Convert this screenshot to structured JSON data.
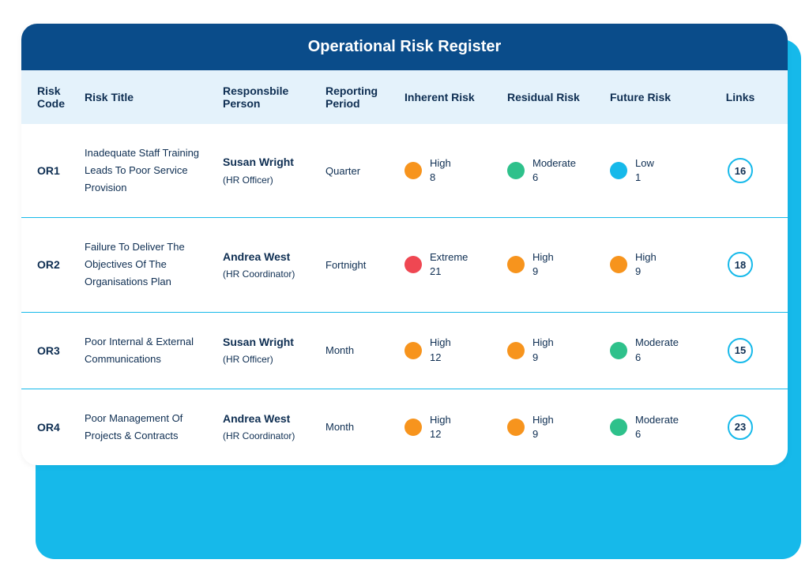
{
  "title": "Operational Risk Register",
  "headers": {
    "code": "Risk Code",
    "title": "Risk Title",
    "person": "Responsbile Person",
    "period": "Reporting Period",
    "inherent": "Inherent Risk",
    "residual": "Residual Risk",
    "future": "Future Risk",
    "links": "Links"
  },
  "colors": {
    "High": "#f7941d",
    "Extreme": "#ef4752",
    "Moderate": "#2ec18b",
    "Low": "#16b9ea"
  },
  "rows": [
    {
      "code": "OR1",
      "title": "Inadequate Staff Training Leads To Poor Service Provision",
      "person": "Susan Wright",
      "role": "(HR Officer)",
      "period": "Quarter",
      "inherent": {
        "level": "High",
        "score": "8"
      },
      "residual": {
        "level": "Moderate",
        "score": "6"
      },
      "future": {
        "level": "Low",
        "score": "1"
      },
      "links": "16"
    },
    {
      "code": "OR2",
      "title": "Failure To Deliver The Objectives Of The Organisations Plan",
      "person": "Andrea West",
      "role": "(HR Coordinator)",
      "period": "Fortnight",
      "inherent": {
        "level": "Extreme",
        "score": "21"
      },
      "residual": {
        "level": "High",
        "score": "9"
      },
      "future": {
        "level": "High",
        "score": "9"
      },
      "links": "18"
    },
    {
      "code": "OR3",
      "title": "Poor Internal & External Communications",
      "person": "Susan Wright",
      "role": "(HR Officer)",
      "period": "Month",
      "inherent": {
        "level": "High",
        "score": "12"
      },
      "residual": {
        "level": "High",
        "score": "9"
      },
      "future": {
        "level": "Moderate",
        "score": "6"
      },
      "links": "15"
    },
    {
      "code": "OR4",
      "title": "Poor Management Of Projects & Contracts",
      "person": "Andrea West",
      "role": "(HR Coordinator)",
      "period": "Month",
      "inherent": {
        "level": "High",
        "score": "12"
      },
      "residual": {
        "level": "High",
        "score": "9"
      },
      "future": {
        "level": "Moderate",
        "score": "6"
      },
      "links": "23"
    }
  ]
}
